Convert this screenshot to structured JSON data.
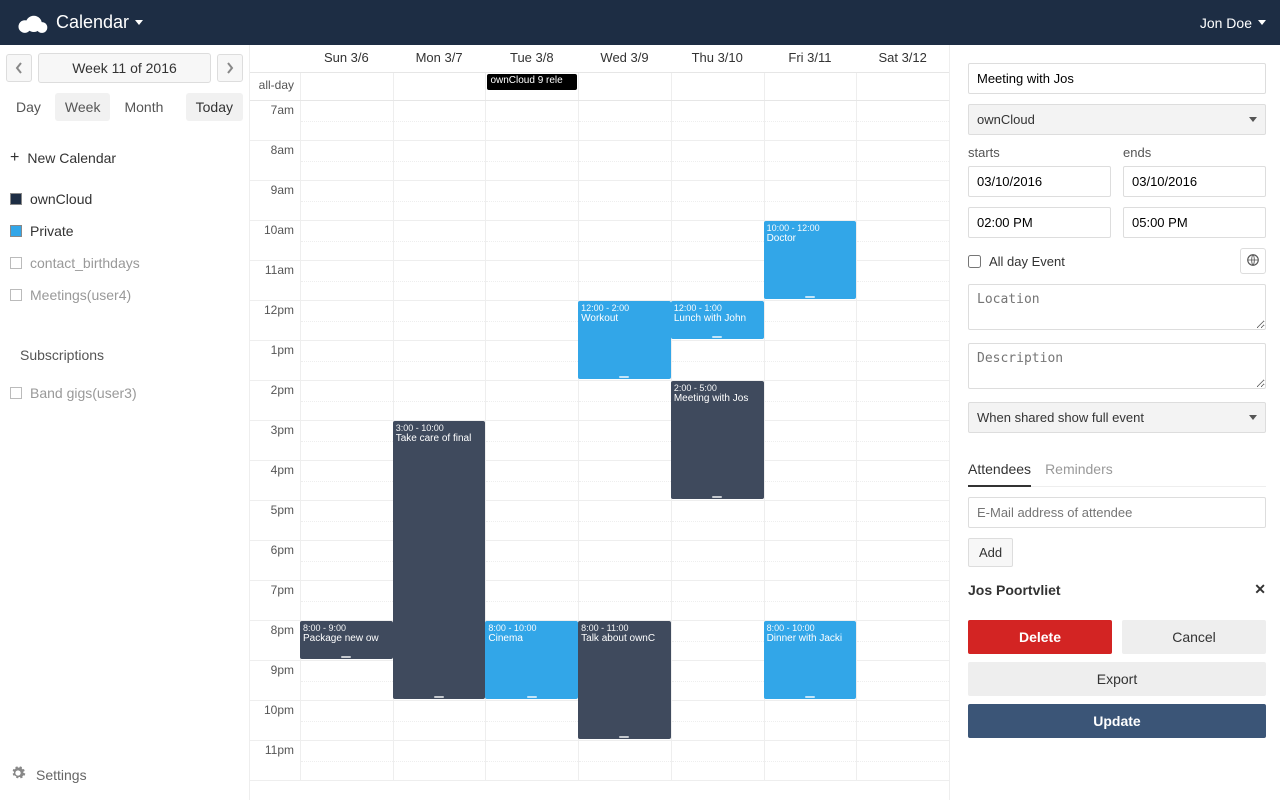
{
  "header": {
    "app_name": "Calendar",
    "user_name": "Jon Doe"
  },
  "sidebar": {
    "week_label": "Week 11 of 2016",
    "views": {
      "day": "Day",
      "week": "Week",
      "month": "Month",
      "today": "Today",
      "active": "Week"
    },
    "new_calendar": "New Calendar",
    "calendars": [
      {
        "label": "ownCloud",
        "color": "#1d2d44",
        "checked": true
      },
      {
        "label": "Private",
        "color": "#32a6e8",
        "checked": true
      },
      {
        "label": "contact_birthdays",
        "color": "transparent",
        "checked": false
      },
      {
        "label": "Meetings(user4)",
        "color": "transparent",
        "checked": false
      }
    ],
    "subscriptions_label": "Subscriptions",
    "subscriptions": [
      {
        "label": "Band gigs(user3)",
        "checked": false
      }
    ],
    "settings": "Settings"
  },
  "calendar": {
    "allday_label": "all-day",
    "days": [
      "Sun 3/6",
      "Mon 3/7",
      "Tue 3/8",
      "Wed 3/9",
      "Thu 3/10",
      "Fri 3/11",
      "Sat 3/12"
    ],
    "hours": [
      "7am",
      "8am",
      "9am",
      "10am",
      "11am",
      "12pm",
      "1pm",
      "2pm",
      "3pm",
      "4pm",
      "5pm",
      "6pm",
      "7pm",
      "8pm",
      "9pm",
      "10pm",
      "11pm"
    ],
    "allday_events": [
      {
        "day": 2,
        "title": "ownCloud 9 rele",
        "color": "dark"
      }
    ],
    "events": [
      {
        "day": 0,
        "start": 20,
        "end": 21,
        "time": "8:00 - 9:00",
        "title": "Package new ow",
        "color": "dark"
      },
      {
        "day": 1,
        "start": 15,
        "end": 22,
        "time": "3:00 - 10:00",
        "title": "Take care of final",
        "color": "dark"
      },
      {
        "day": 2,
        "start": 20,
        "end": 22,
        "time": "8:00 - 10:00",
        "title": "Cinema",
        "color": "blue"
      },
      {
        "day": 3,
        "start": 12,
        "end": 14,
        "time": "12:00 - 2:00",
        "title": "Workout",
        "color": "blue"
      },
      {
        "day": 3,
        "start": 20,
        "end": 23,
        "time": "8:00 - 11:00",
        "title": "Talk about ownC",
        "color": "dark"
      },
      {
        "day": 4,
        "start": 12,
        "end": 13,
        "time": "12:00 - 1:00",
        "title": "Lunch with John",
        "color": "blue"
      },
      {
        "day": 4,
        "start": 14,
        "end": 17,
        "time": "2:00 - 5:00",
        "title": "Meeting with Jos",
        "color": "dark"
      },
      {
        "day": 5,
        "start": 10,
        "end": 12,
        "time": "10:00 - 12:00",
        "title": "Doctor",
        "color": "blue"
      },
      {
        "day": 5,
        "start": 20,
        "end": 22,
        "time": "8:00 - 10:00",
        "title": "Dinner with Jacki",
        "color": "blue"
      }
    ]
  },
  "details": {
    "title_value": "Meeting with Jos",
    "calendar_select": "ownCloud",
    "starts_label": "starts",
    "ends_label": "ends",
    "start_date": "03/10/2016",
    "end_date": "03/10/2016",
    "start_time": "02:00 PM",
    "end_time": "05:00 PM",
    "allday_label": "All day Event",
    "location_placeholder": "Location",
    "description_placeholder": "Description",
    "share_select": "When shared show full event",
    "tabs": {
      "attendees": "Attendees",
      "reminders": "Reminders",
      "active": "Attendees"
    },
    "attendee_placeholder": "E-Mail address of attendee",
    "add_label": "Add",
    "attendee_name": "Jos Poortvliet",
    "buttons": {
      "delete": "Delete",
      "cancel": "Cancel",
      "export": "Export",
      "update": "Update"
    }
  }
}
